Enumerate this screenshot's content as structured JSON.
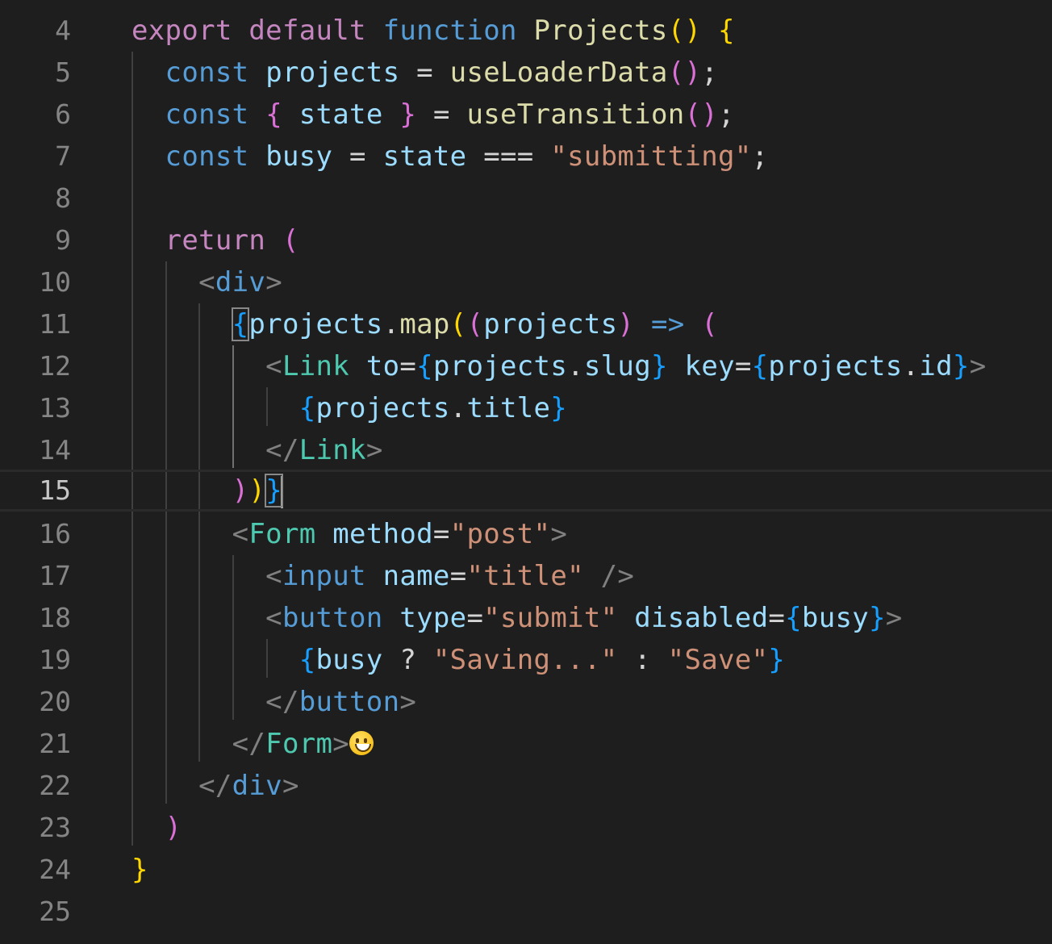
{
  "editor": {
    "current_line": "15",
    "line_numbers": [
      "4",
      "5",
      "6",
      "7",
      "8",
      "9",
      "10",
      "11",
      "12",
      "13",
      "14",
      "15",
      "16",
      "17",
      "18",
      "19",
      "20",
      "21",
      "22",
      "23",
      "24",
      "25"
    ],
    "tokens": {
      "export": "export",
      "default": "default",
      "function": "function",
      "projects_fn": "Projects",
      "const": "const",
      "projects": "projects",
      "useLoaderData": "useLoaderData",
      "state": "state",
      "useTransition": "useTransition",
      "busy": "busy",
      "submitting": "\"submitting\"",
      "return": "return",
      "div": "div",
      "map": "map",
      "Link": "Link",
      "to": "to",
      "slug": "slug",
      "key": "key",
      "id": "id",
      "title_prop": "title",
      "Form": "Form",
      "method": "method",
      "post": "\"post\"",
      "input": "input",
      "name": "name",
      "title_str": "\"title\"",
      "button": "button",
      "type": "type",
      "submit": "\"submit\"",
      "disabled": "disabled",
      "saving": "\"Saving...\"",
      "save": "\"Save\""
    }
  },
  "colors": {
    "background": "#1e1e1e",
    "keyword_control": "#c586c0",
    "keyword_storage": "#569cd6",
    "variable": "#9cdcfe",
    "function": "#dcdcaa",
    "string": "#ce9178",
    "component": "#4ec9b0",
    "bracket_1": "#ffd700",
    "bracket_2": "#da70d6",
    "bracket_3": "#179fff"
  }
}
